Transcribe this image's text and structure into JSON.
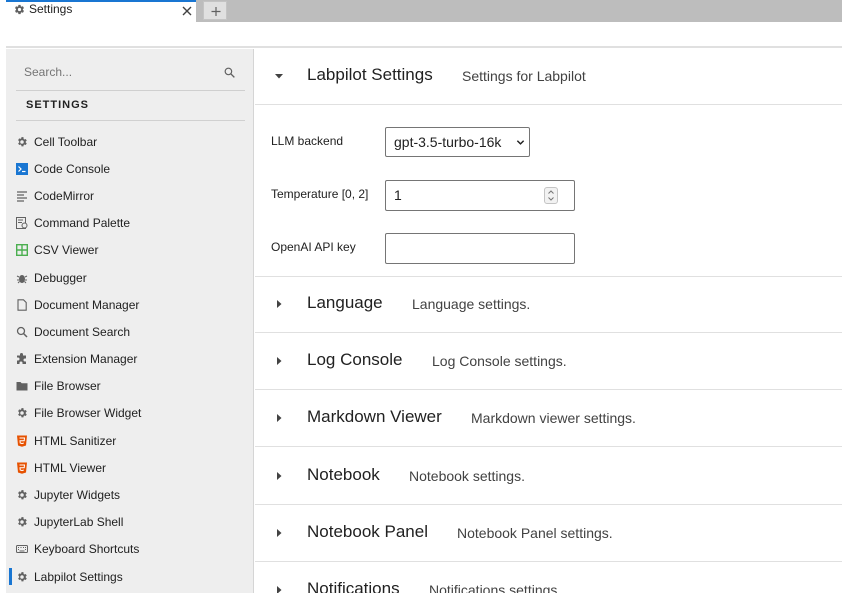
{
  "tabs": [
    {
      "label": "Settings",
      "icon": "gear-icon",
      "active": true
    }
  ],
  "add_tab_symbol": "+",
  "sidebar": {
    "search_placeholder": "Search...",
    "section_title": "SETTINGS",
    "items": [
      {
        "label": "Cell Toolbar",
        "icon": "gear-icon"
      },
      {
        "label": "Code Console",
        "icon": "terminal-icon"
      },
      {
        "label": "CodeMirror",
        "icon": "text-lines-icon"
      },
      {
        "label": "Command Palette",
        "icon": "palette-icon"
      },
      {
        "label": "CSV Viewer",
        "icon": "spreadsheet-icon"
      },
      {
        "label": "Debugger",
        "icon": "bug-icon"
      },
      {
        "label": "Document Manager",
        "icon": "file-icon"
      },
      {
        "label": "Document Search",
        "icon": "search-icon"
      },
      {
        "label": "Extension Manager",
        "icon": "puzzle-icon"
      },
      {
        "label": "File Browser",
        "icon": "folder-icon"
      },
      {
        "label": "File Browser Widget",
        "icon": "gear-icon"
      },
      {
        "label": "HTML Sanitizer",
        "icon": "html5-icon"
      },
      {
        "label": "HTML Viewer",
        "icon": "html5-icon"
      },
      {
        "label": "Jupyter Widgets",
        "icon": "gear-icon"
      },
      {
        "label": "JupyterLab Shell",
        "icon": "gear-icon"
      },
      {
        "label": "Keyboard Shortcuts",
        "icon": "keyboard-icon"
      },
      {
        "label": "Labpilot Settings",
        "icon": "gear-icon",
        "selected": true
      }
    ]
  },
  "main": {
    "expanded_group": {
      "title": "Labpilot Settings",
      "description": "Settings for Labpilot",
      "fields": {
        "llm_backend": {
          "label": "LLM backend",
          "value": "gpt-3.5-turbo-16k"
        },
        "temperature": {
          "label": "Temperature [0, 2]",
          "value": "1"
        },
        "api_key": {
          "label": "OpenAI API key",
          "value": ""
        }
      }
    },
    "groups": [
      {
        "title": "Language",
        "description": "Language settings."
      },
      {
        "title": "Log Console",
        "description": "Log Console settings."
      },
      {
        "title": "Markdown Viewer",
        "description": "Markdown viewer settings."
      },
      {
        "title": "Notebook",
        "description": "Notebook settings."
      },
      {
        "title": "Notebook Panel",
        "description": "Notebook Panel settings."
      },
      {
        "title": "Notifications",
        "description": "Notifications settings."
      }
    ]
  },
  "colors": {
    "accent": "#1976d2",
    "sidebar_bg": "#eeeeee",
    "tabbar_bg": "#bdbdbd",
    "html5_icon": "#e65100",
    "csv_icon": "#4caf50",
    "terminal_icon": "#1976d2"
  }
}
